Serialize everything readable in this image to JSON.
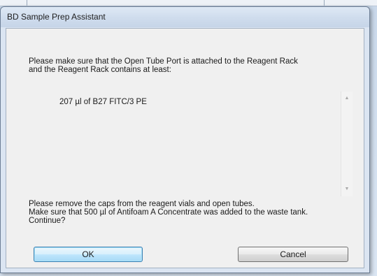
{
  "window": {
    "title": "BD Sample Prep Assistant"
  },
  "message": {
    "line1": "Please make sure that the Open Tube Port is attached to the Reagent Rack",
    "line2": "and the Reagent Rack contains at least:",
    "reagent_requirement": "207 µl of B27 FITC/3 PE",
    "bottom_line1": "Please remove the caps from the reagent vials and open tubes.",
    "bottom_line2": "Make sure that 500 µl of Antifoam A Concentrate was added to the waste tank.",
    "bottom_line3": "Continue?"
  },
  "buttons": {
    "ok_label": "OK",
    "cancel_label": "Cancel"
  },
  "scrollbar": {
    "up_arrow_icon": "▲",
    "down_arrow_icon": "▼"
  },
  "colors": {
    "default_button_border": "#3c7fb1",
    "dialog_background": "#f0f0f0",
    "titlebar": "#cfdced"
  }
}
